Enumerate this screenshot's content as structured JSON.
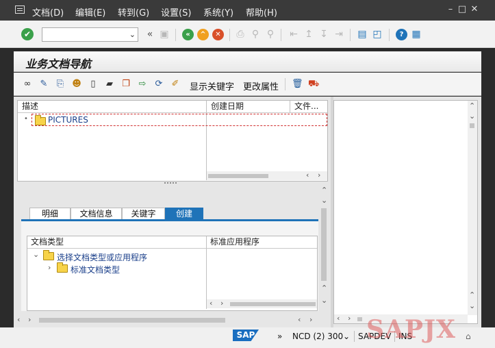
{
  "menubar": {
    "items": [
      "文档(D)",
      "编辑(E)",
      "转到(G)",
      "设置(S)",
      "系统(Y)",
      "帮助(H)"
    ],
    "window_buttons": [
      "–",
      "□",
      "✕"
    ]
  },
  "toolbar": {
    "command_field_value": "",
    "back_label": "«"
  },
  "page_title": "业务文档导航",
  "app_toolbar": {
    "show_keywords": "显示关键字",
    "change_attributes": "更改属性"
  },
  "top_tree": {
    "columns": [
      "描述",
      "创建日期",
      "文件..."
    ],
    "rows": [
      {
        "bullet": "•",
        "label": "PICTURES"
      }
    ]
  },
  "tabs": [
    {
      "label": "明细",
      "active": false
    },
    {
      "label": "文档信息",
      "active": false
    },
    {
      "label": "关键字",
      "active": false
    },
    {
      "label": "创建",
      "active": true
    }
  ],
  "create_tree": {
    "columns": [
      "文档类型",
      "标准应用程序"
    ],
    "rows": [
      {
        "expander": "⌄",
        "label": "选择文档类型或应用程序"
      },
      {
        "expander": "›",
        "label": "标准文档类型"
      }
    ]
  },
  "statusbar": {
    "sap_logo": "SAP",
    "system": "NCD (2) 300",
    "user": "SAPDEV",
    "mode": "INS"
  },
  "watermark": "SAPJX",
  "colors": {
    "accent": "#1f73b8",
    "menubar": "#3a3a3a",
    "ok": "#3aa04a",
    "cancel": "#d9502a",
    "exit": "#f0a020"
  }
}
